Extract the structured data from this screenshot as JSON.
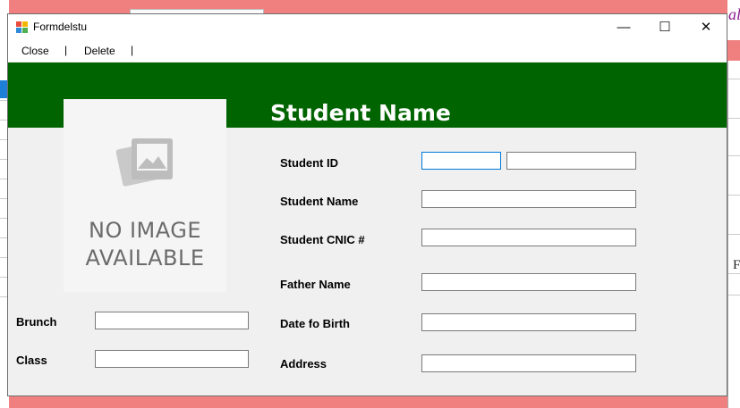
{
  "window": {
    "title": "Formdelstu"
  },
  "window_controls": {
    "minimize": "—",
    "maximize": "☐",
    "close": "✕"
  },
  "menu": {
    "close": "Close",
    "delete": "Delete",
    "separator": "|"
  },
  "header": {
    "title": "Student Name"
  },
  "photo": {
    "placeholder_line1": "NO IMAGE",
    "placeholder_line2": "AVAILABLE"
  },
  "fields": {
    "student_id": {
      "label": "Student ID",
      "value": "",
      "value2": ""
    },
    "student_name": {
      "label": "Student Name",
      "value": ""
    },
    "student_cnic": {
      "label": "Student CNIC #",
      "value": ""
    },
    "father_name": {
      "label": "Father Name",
      "value": ""
    },
    "date_of_birth": {
      "label": "Date fo Birth",
      "value": ""
    },
    "address": {
      "label": "Address",
      "value": ""
    },
    "brunch": {
      "label": "Brunch",
      "value": ""
    },
    "class": {
      "label": "Class",
      "value": ""
    }
  },
  "background": {
    "right_fragment": "al",
    "right_row_char": "F"
  },
  "colors": {
    "header_green": "#006400",
    "background_pink": "#f08080",
    "focus_border": "#0078d7"
  }
}
